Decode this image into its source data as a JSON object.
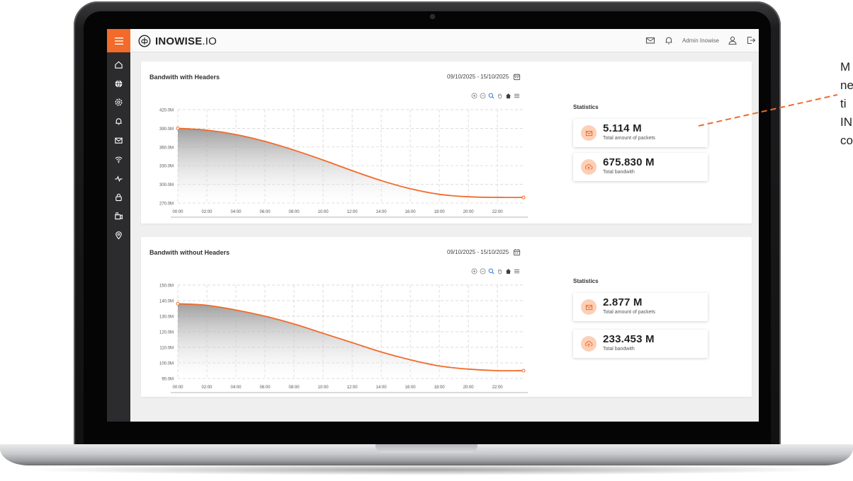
{
  "app": {
    "logo_text_bold": "INOWISE",
    "logo_text_light": ".IO"
  },
  "header": {
    "admin_name": "Admin Inowise",
    "icons": [
      "mail-icon",
      "bell-icon",
      "user-icon",
      "logout-icon"
    ]
  },
  "sidebar": {
    "items": [
      "home-icon",
      "globe-icon",
      "settings-icon",
      "bell-icon",
      "mail-icon",
      "wifi-icon",
      "activity-icon",
      "lock-icon",
      "camera-icon",
      "location-icon"
    ]
  },
  "callout": {
    "text": "M\nne\nti\nIN\nco"
  },
  "panels": [
    {
      "title": "Bandwith with Headers",
      "date_range": "09/10/2025 - 15/10/2025",
      "stats_title": "Statistics",
      "stats": [
        {
          "value": "5.114 M",
          "label": "Total amount of packets",
          "icon": "mail-icon"
        },
        {
          "value": "675.830 M",
          "label": "Total bandwith",
          "icon": "cloud-upload-icon"
        }
      ]
    },
    {
      "title": "Bandwith without Headers",
      "date_range": "09/10/2025 - 15/10/2025",
      "stats_title": "Statistics",
      "stats": [
        {
          "value": "2.877 M",
          "label": "Total amount of packets",
          "icon": "mail-icon"
        },
        {
          "value": "233.453 M",
          "label": "Total bandwith",
          "icon": "cloud-upload-icon"
        }
      ]
    }
  ],
  "colors": {
    "accent": "#f26b2a",
    "sidebar": "#2c2c2e",
    "badge": "#fbd0b7"
  },
  "chart_data": [
    {
      "type": "area",
      "categories": [
        "00:00",
        "02:00",
        "04:00",
        "06:00",
        "08:00",
        "10:00",
        "12:00",
        "14:00",
        "16:00",
        "18:00",
        "20:00",
        "22:00"
      ],
      "yticks": [
        "270.0M",
        "300.0M",
        "330.0M",
        "360.0M",
        "390.0M",
        "420.0M"
      ],
      "ylim": [
        270,
        420
      ],
      "x": [
        0,
        2,
        4,
        6,
        8,
        10,
        12,
        14,
        16,
        18,
        20,
        22,
        23.8
      ],
      "values": [
        390,
        387,
        380,
        369,
        355,
        339,
        322,
        306,
        293,
        284,
        280,
        279,
        279
      ],
      "grid": true
    },
    {
      "type": "area",
      "categories": [
        "00:00",
        "02:00",
        "04:00",
        "06:00",
        "08:00",
        "10:00",
        "12:00",
        "14:00",
        "16:00",
        "18:00",
        "20:00",
        "22:00"
      ],
      "yticks": [
        "90.0M",
        "100.0M",
        "110.0M",
        "120.0M",
        "130.0M",
        "140.0M",
        "150.0M"
      ],
      "ylim": [
        90,
        150
      ],
      "x": [
        0,
        2,
        4,
        6,
        8,
        10,
        12,
        14,
        16,
        18,
        20,
        22,
        23.8
      ],
      "values": [
        138,
        137,
        134,
        130,
        125,
        119,
        113,
        107,
        102,
        98,
        96,
        95,
        95
      ],
      "grid": true
    }
  ]
}
